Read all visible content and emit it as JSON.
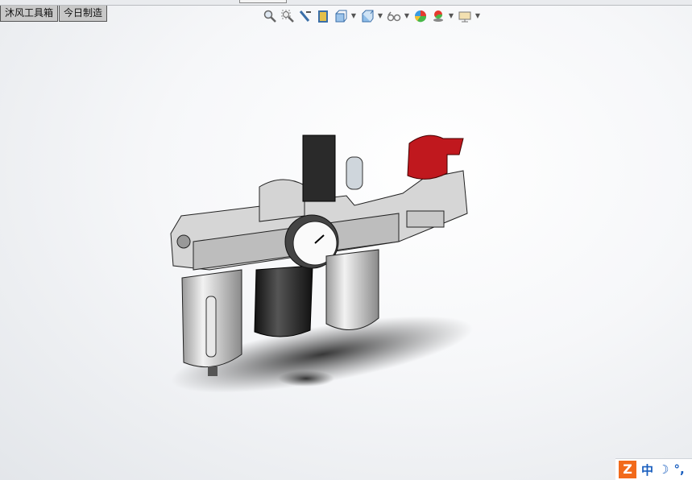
{
  "tabs": [
    "沐风工具箱",
    "今日制造"
  ],
  "toolbar": [
    {
      "icon": "zoom-to-fit-icon",
      "dropdown": false
    },
    {
      "icon": "zoom-to-area-icon",
      "dropdown": false
    },
    {
      "icon": "previous-view-icon",
      "dropdown": false
    },
    {
      "icon": "section-view-icon",
      "dropdown": false
    },
    {
      "icon": "view-orientation-icon",
      "dropdown": true
    },
    {
      "icon": "display-style-icon",
      "dropdown": true
    },
    {
      "icon": "hide-show-items-icon",
      "dropdown": true
    },
    {
      "icon": "edit-appearance-icon",
      "dropdown": false
    },
    {
      "icon": "apply-scene-icon",
      "dropdown": true
    },
    {
      "icon": "view-settings-icon",
      "dropdown": true
    }
  ],
  "ime": {
    "logo": "Z",
    "mode": "中",
    "moon": "☽",
    "punct": "°,"
  },
  "colors": {
    "handle": "#c0181e",
    "body": "#d9d9d9",
    "bowl": "#222222"
  }
}
